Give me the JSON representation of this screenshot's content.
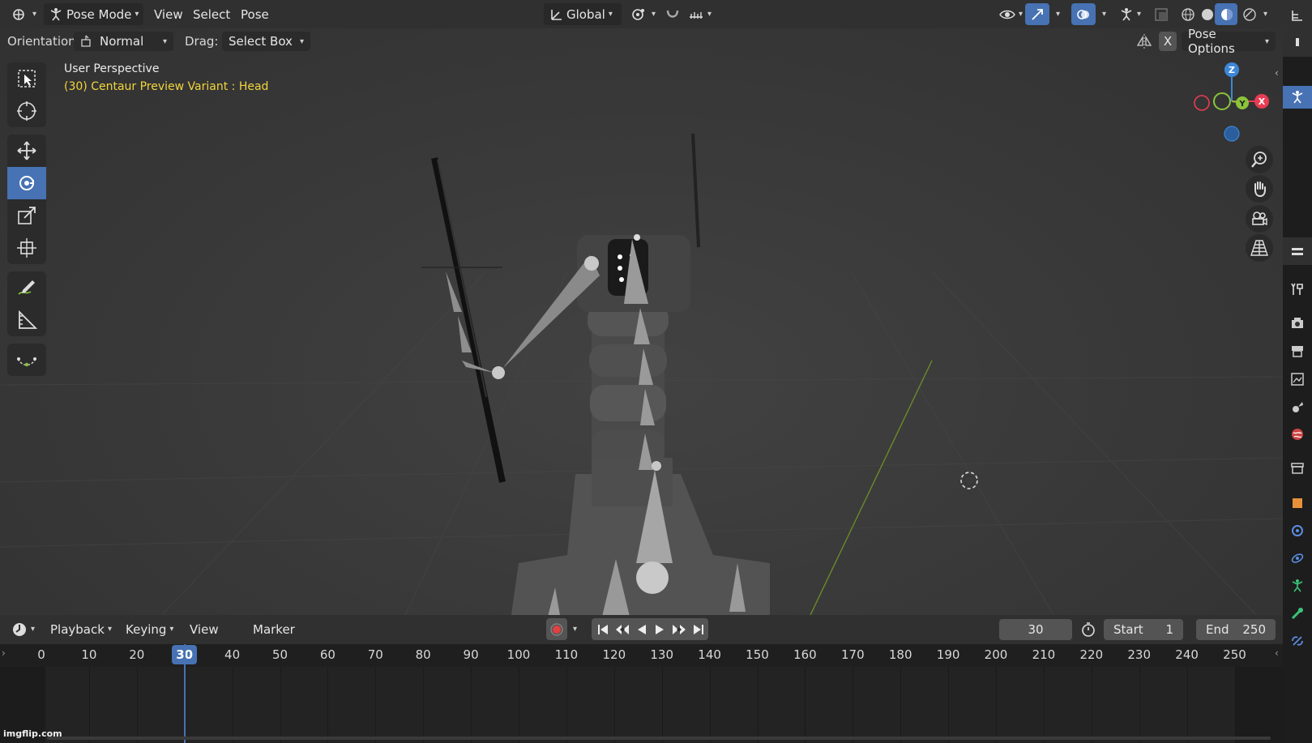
{
  "header": {
    "mode": "Pose Mode",
    "menus": [
      "View",
      "Select",
      "Pose"
    ],
    "transform_orientation": "Global"
  },
  "tool_settings": {
    "orientation_label": "Orientation:",
    "orientation_value": "Normal",
    "drag_label": "Drag:",
    "drag_value": "Select Box",
    "x_label": "X",
    "pose_options": "Pose Options"
  },
  "viewport": {
    "view_name": "User Perspective",
    "object_info": "(30) Centaur Preview Variant : Head",
    "gizmo": {
      "z": "Z",
      "y": "Y",
      "x": "X"
    }
  },
  "timeline": {
    "menus": [
      "Playback",
      "Keying",
      "View",
      "Marker"
    ],
    "current_frame": "30",
    "start_label": "Start",
    "start_value": "1",
    "end_label": "End",
    "end_value": "250",
    "ticks": [
      "0",
      "10",
      "20",
      "30",
      "40",
      "50",
      "60",
      "70",
      "80",
      "90",
      "100",
      "110",
      "120",
      "130",
      "140",
      "150",
      "160",
      "170",
      "180",
      "190",
      "200",
      "210",
      "220",
      "230",
      "240",
      "250"
    ]
  },
  "watermark": "imgflip.com",
  "colors": {
    "active_blue": "#4772b3",
    "overlay_yellow": "#f2d53c",
    "axis_x": "#e83c52",
    "axis_y": "#8ac43a",
    "axis_z": "#3d87d8",
    "record_red": "#e14141"
  }
}
